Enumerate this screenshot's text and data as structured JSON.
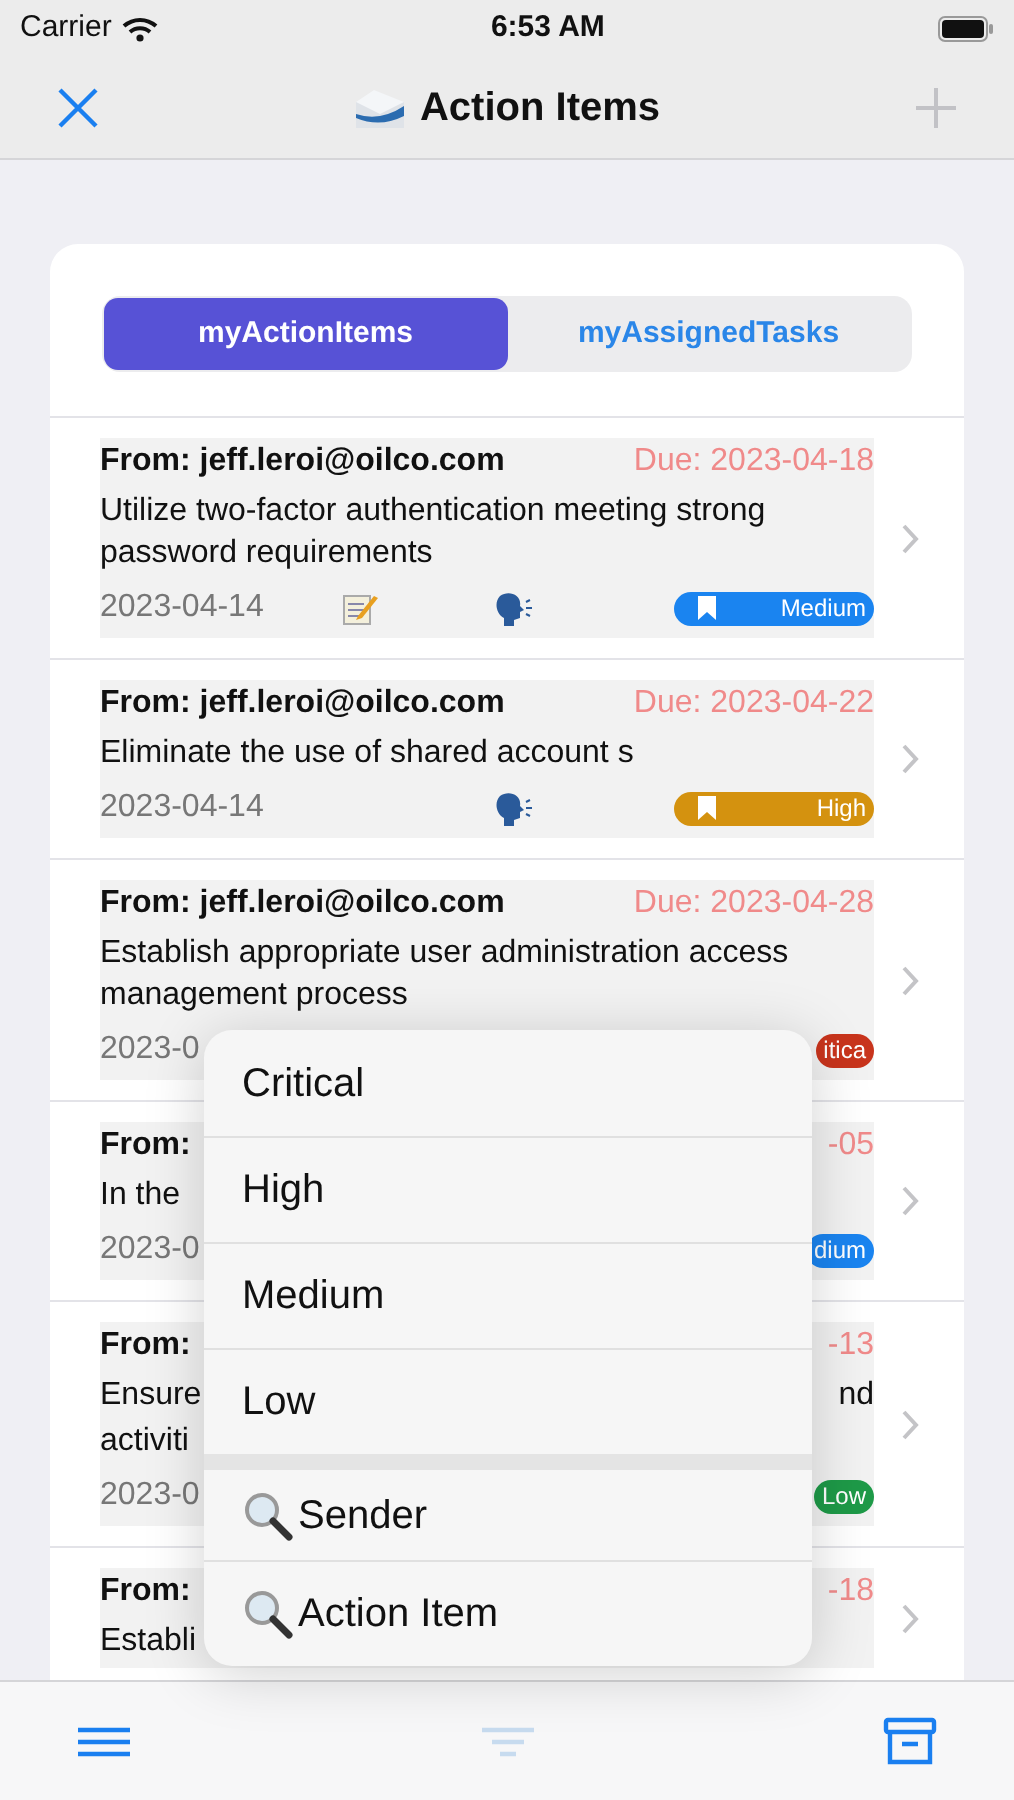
{
  "status_bar": {
    "carrier": "Carrier",
    "time": "6:53 AM"
  },
  "nav": {
    "title": "Action Items",
    "add_disabled": true
  },
  "segments": [
    {
      "label": "myActionItems",
      "selected": true
    },
    {
      "label": "myAssignedTasks",
      "selected": false
    }
  ],
  "rows": [
    {
      "kind": "full",
      "sender": "From: jeff.leroi@oilco.com",
      "due": "Due: 2023-04-18",
      "title": "Utilize two-factor authentication meeting strong password requirements",
      "date": "2023-04-14",
      "has_note": true,
      "has_speech": true,
      "badge": {
        "label": "Medium",
        "color": "#1a84f0"
      }
    },
    {
      "kind": "full",
      "sender": "From: jeff.leroi@oilco.com",
      "due": "Due: 2023-04-22",
      "title": "Eliminate the use of shared account s",
      "date": "2023-04-14",
      "has_note": false,
      "has_speech": true,
      "badge": {
        "label": "High",
        "color": "#d4920f"
      }
    },
    {
      "kind": "partial",
      "sender": "From: jeff.leroi@oilco.com",
      "due": "Due: 2023-04-28",
      "title": "Establish appropriate user administration access management process",
      "date": "2023-0",
      "badge": {
        "label": "itica",
        "color": "#c8341c"
      }
    },
    {
      "kind": "covered",
      "sender": "From:",
      "due": "-05",
      "title_lines": [
        {
          "left": "In the"
        }
      ],
      "date": "2023-0",
      "badge": {
        "label": "dium",
        "color": "#1a84f0"
      }
    },
    {
      "kind": "covered",
      "sender": "From:",
      "due": "-13",
      "title_lines": [
        {
          "left": "Ensure",
          "right": "nd"
        },
        {
          "left": "activiti"
        }
      ],
      "date": "2023-0",
      "badge": {
        "label": "Low",
        "color": "#1e9a48"
      }
    },
    {
      "kind": "covered",
      "sender": "From:",
      "due": "-18",
      "title_lines": [
        {
          "left": "Establi"
        }
      ]
    }
  ],
  "menu": [
    {
      "label": "Critical",
      "kind": "priority"
    },
    {
      "label": "High",
      "kind": "priority"
    },
    {
      "label": "Medium",
      "kind": "priority"
    },
    {
      "label": "Low",
      "kind": "priority"
    },
    {
      "label": "Sender",
      "kind": "search"
    },
    {
      "label": "Action Item",
      "kind": "search"
    }
  ],
  "toolbar": [
    {
      "kind": "menu",
      "disabled": false
    },
    {
      "kind": "filter",
      "disabled": true
    },
    {
      "kind": "archive",
      "disabled": false
    }
  ]
}
